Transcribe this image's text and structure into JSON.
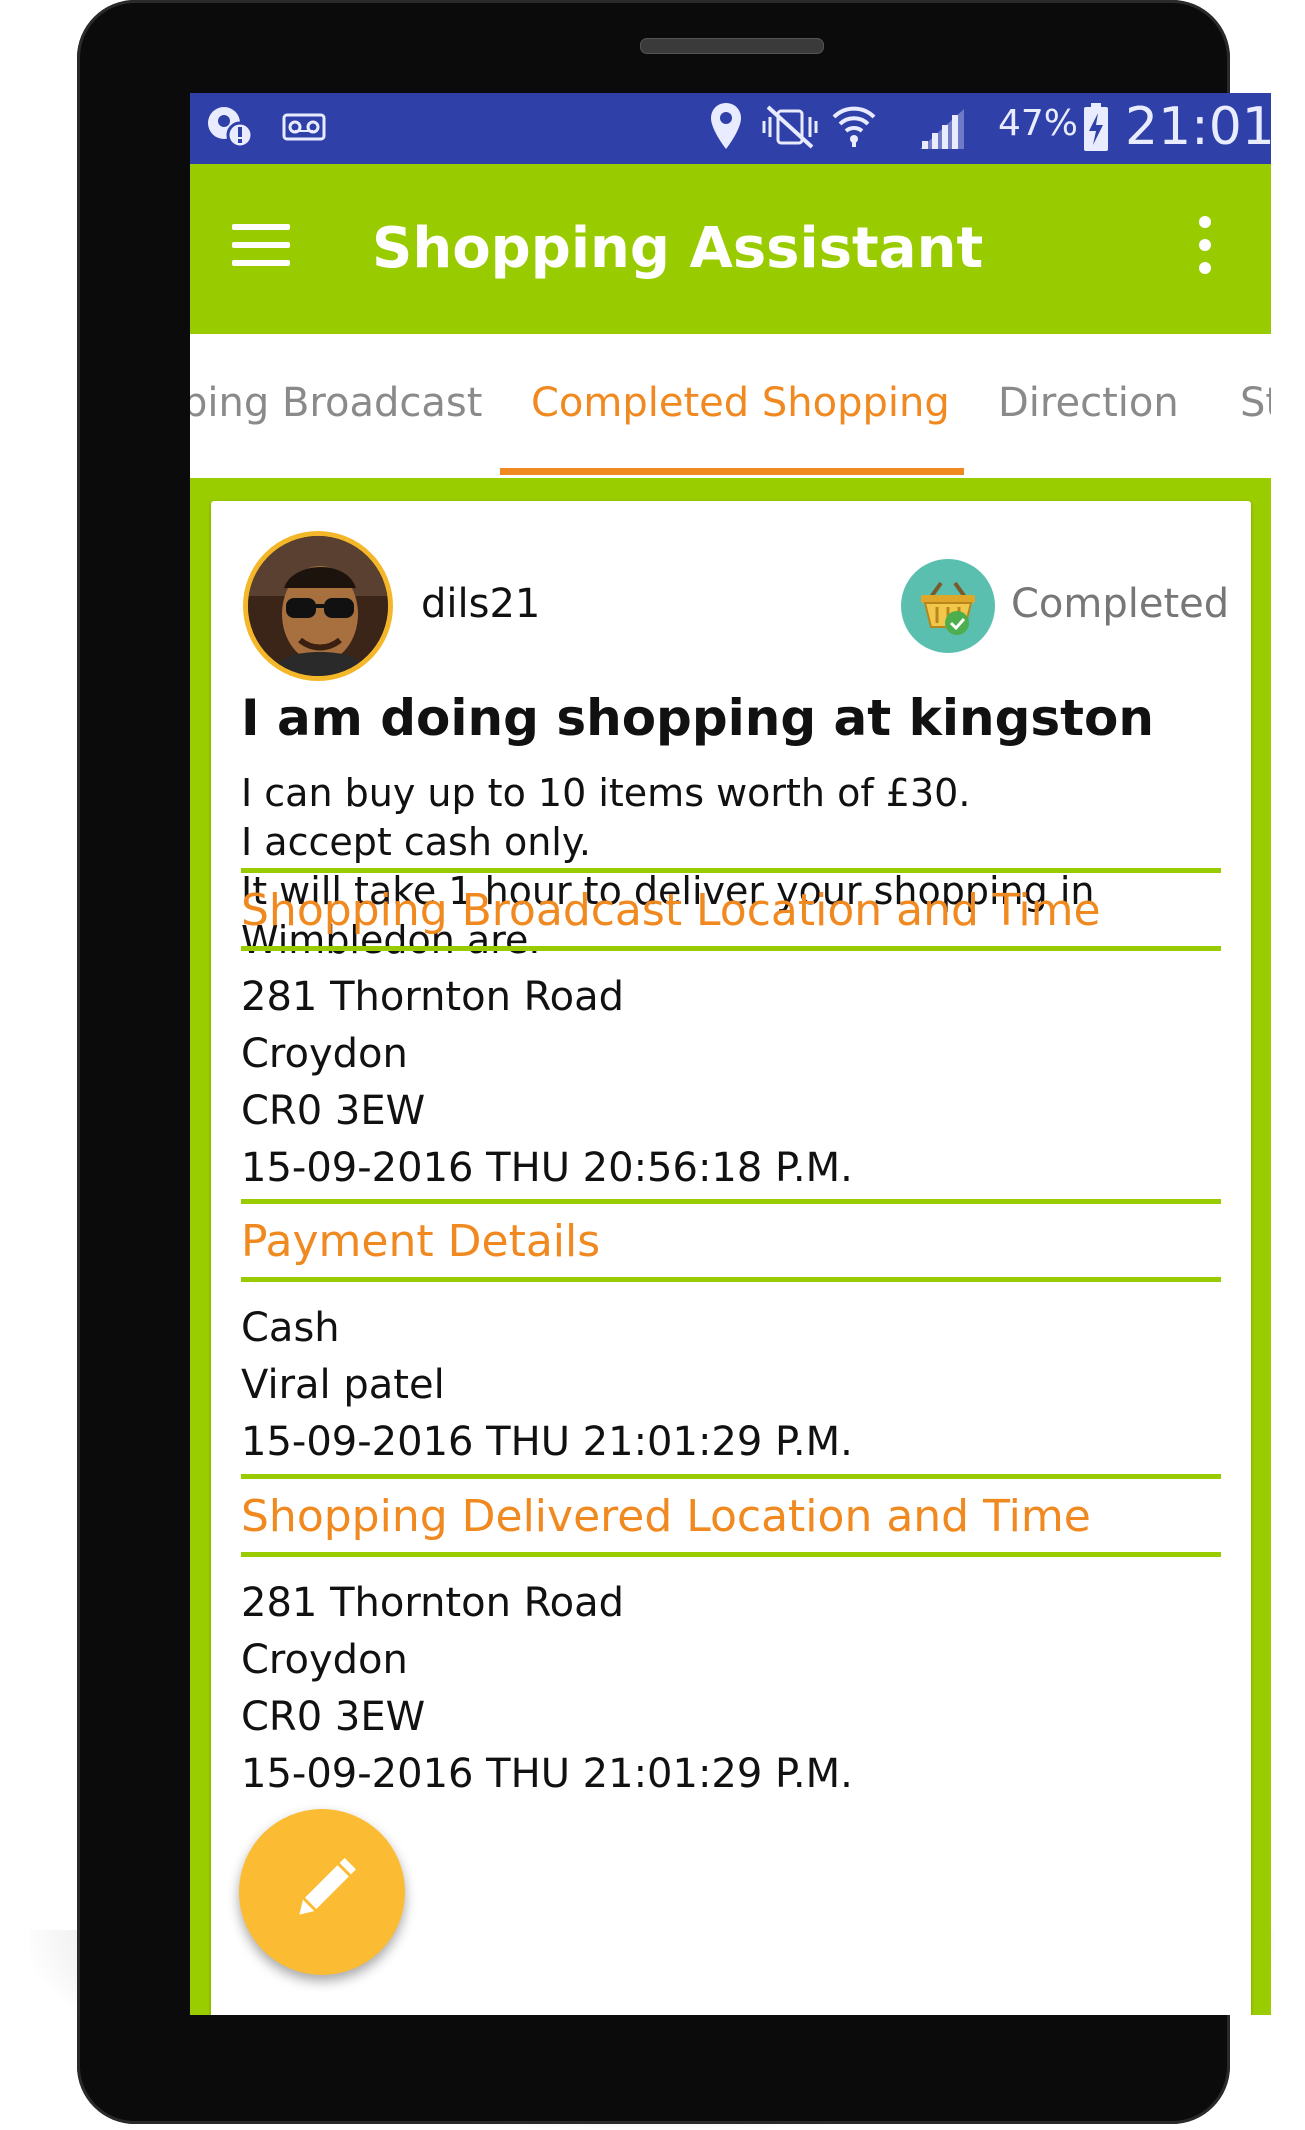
{
  "status_bar": {
    "battery_percent": "47%",
    "time": "21:01",
    "icons": [
      "location-alert-icon",
      "voicemail-icon",
      "location-pin-icon",
      "vibrate-off-icon",
      "wifi-icon",
      "cell-signal-icon",
      "battery-charging-icon"
    ]
  },
  "app_bar": {
    "title": "Shopping Assistant",
    "menu_icon": "hamburger-menu-icon",
    "overflow_icon": "more-vert-icon"
  },
  "tabs": [
    {
      "label": "ping Broadcast",
      "active": false
    },
    {
      "label": "Completed Shopping",
      "active": true
    },
    {
      "label": "Direction",
      "active": false
    },
    {
      "label": "St",
      "active": false
    }
  ],
  "post": {
    "username": "dils21",
    "status": "Completed",
    "status_icon": "basket-check-icon",
    "title": "I am doing shopping at kingston",
    "description_lines": [
      "I can buy up to 10 items worth of £30.",
      "I accept cash only.",
      "It will take 1 hour to deliver your shopping in",
      "Wimbledon are."
    ]
  },
  "sections": [
    {
      "title": "Shopping Broadcast Location and Time",
      "lines": [
        "281 Thornton Road",
        "Croydon",
        "CR0 3EW",
        "15-09-2016 THU 20:56:18 P.M."
      ]
    },
    {
      "title": "Payment Details",
      "lines": [
        "Cash",
        "Viral patel",
        "15-09-2016 THU 21:01:29 P.M."
      ]
    },
    {
      "title": "Shopping Delivered Location and Time",
      "lines": [
        "281 Thornton Road",
        "Croydon",
        "CR0 3EW",
        "15-09-2016 THU 21:01:29 P.M."
      ]
    }
  ],
  "fab": {
    "icon": "edit-pencil-icon"
  },
  "colors": {
    "status_bar": "#2f40a8",
    "primary": "#99cc00",
    "accent": "#f0891f",
    "fab": "#fbbc33"
  }
}
